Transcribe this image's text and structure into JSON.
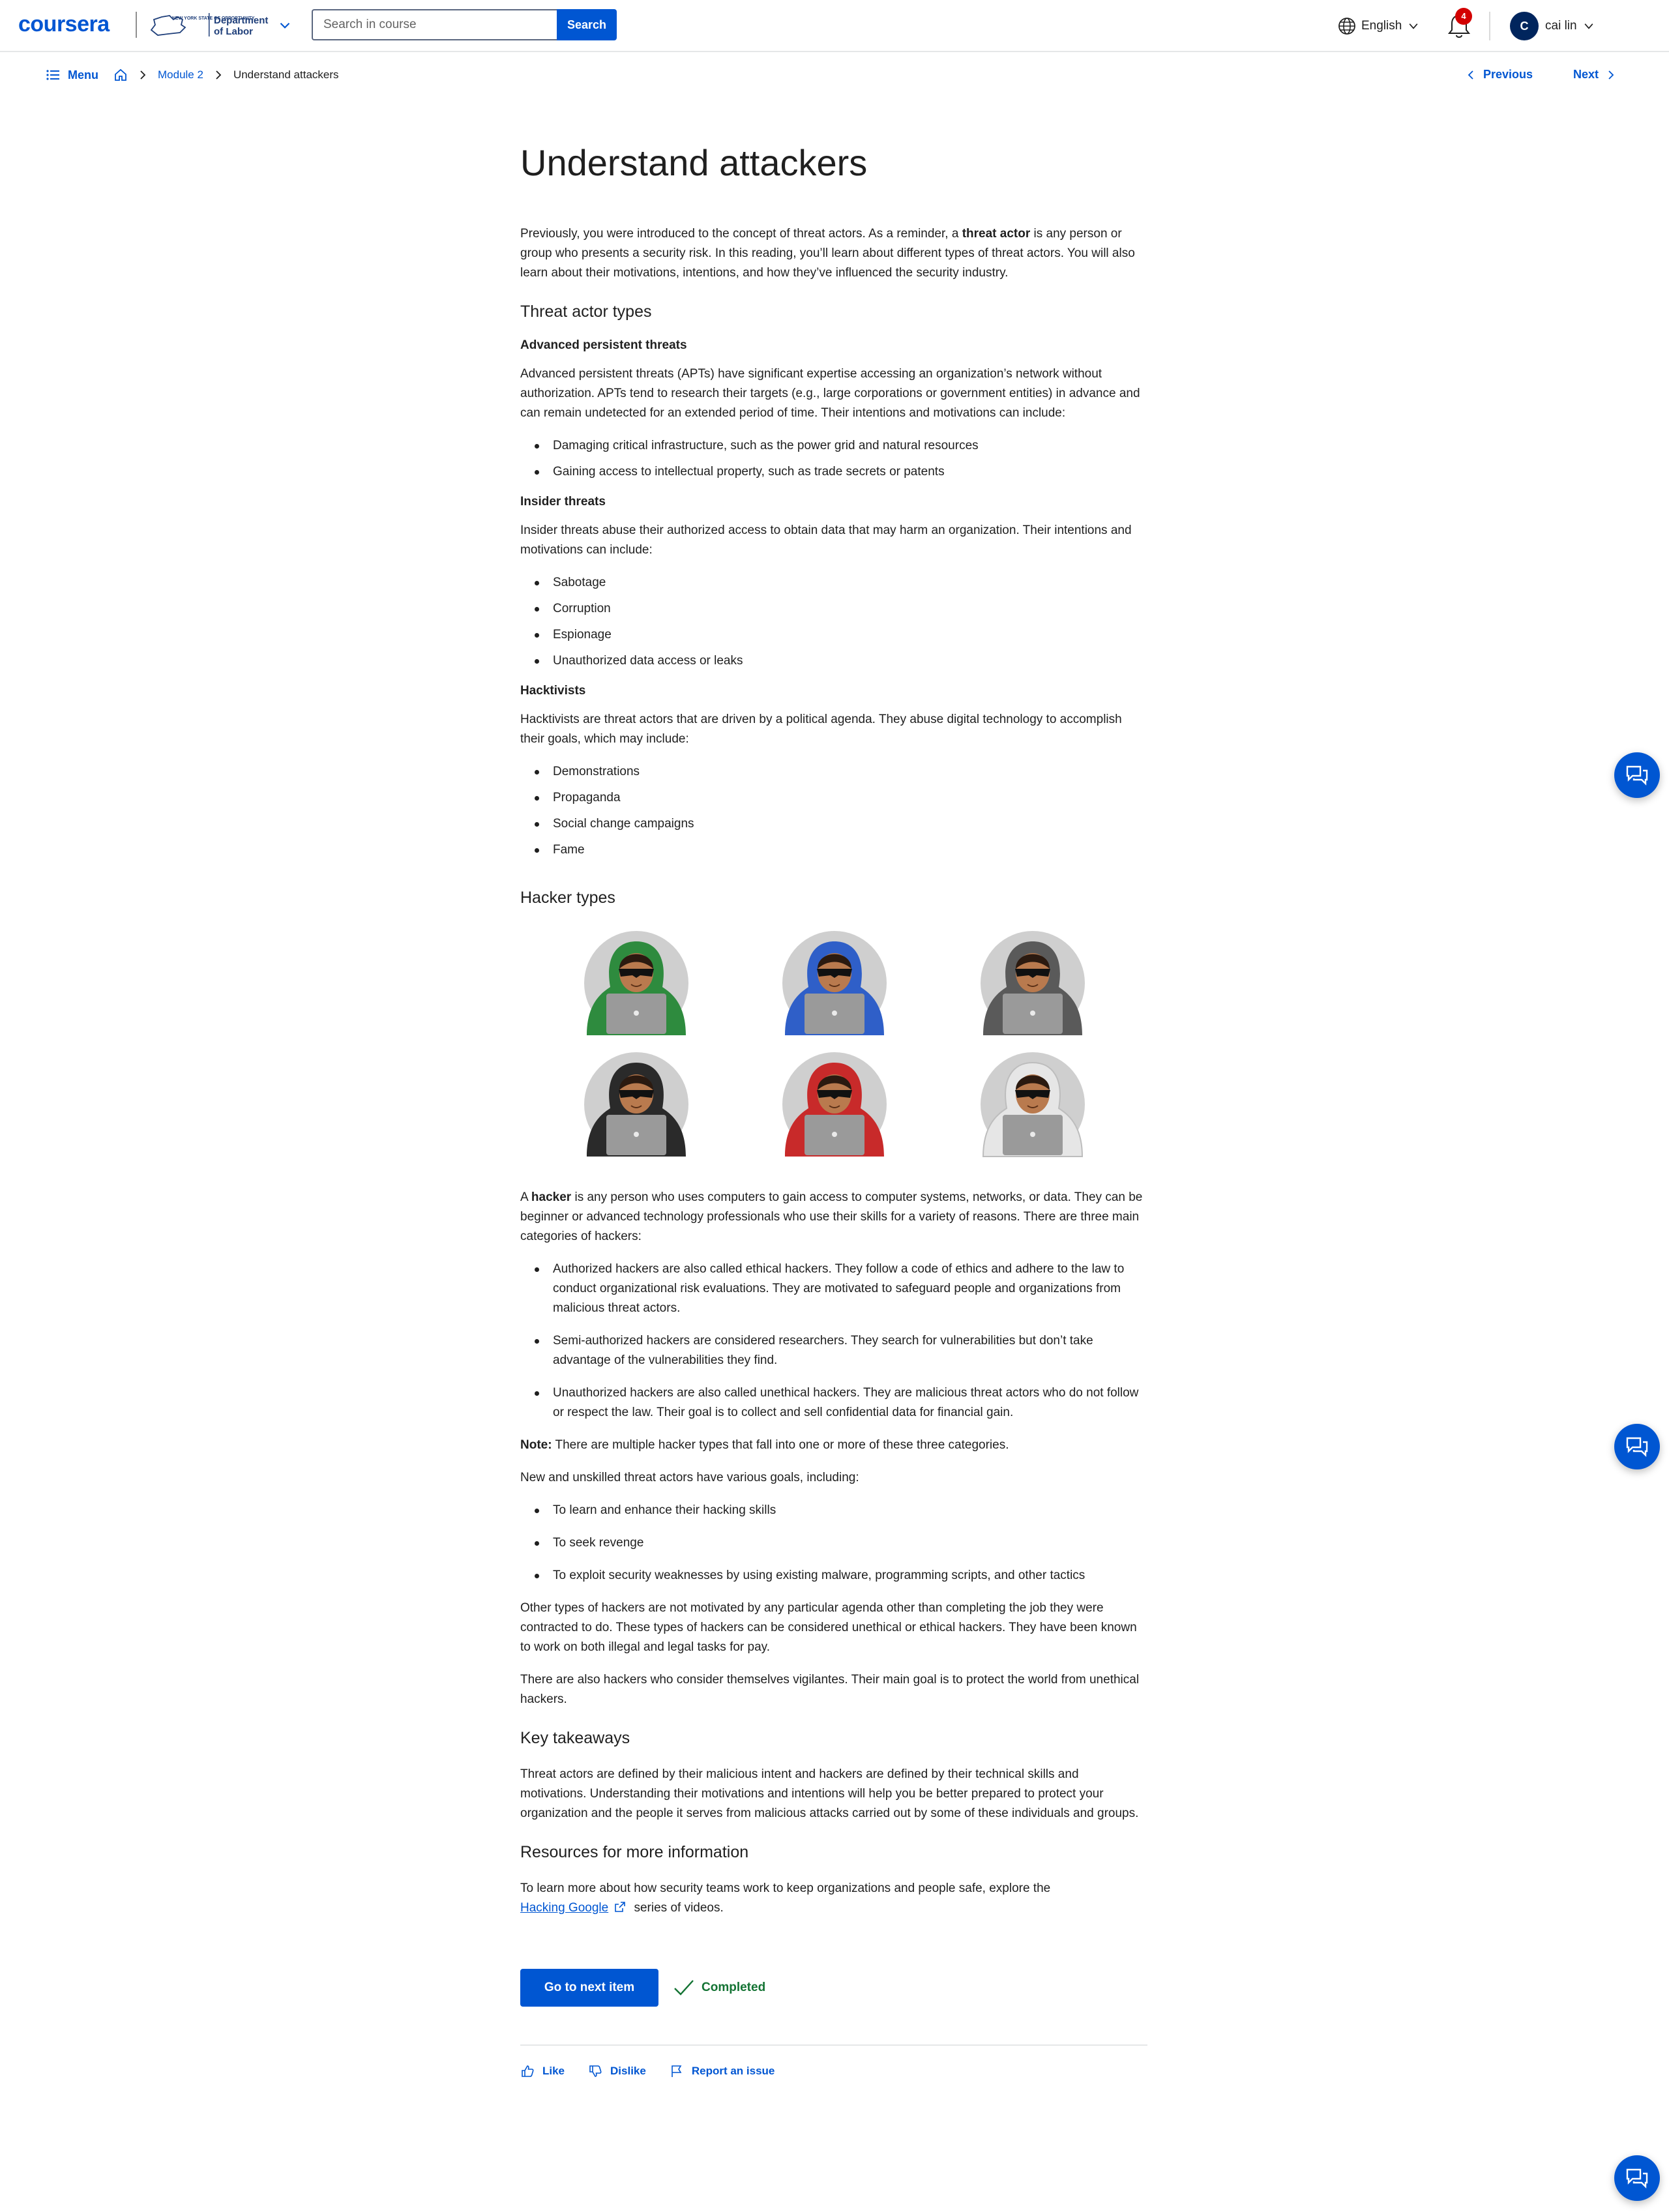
{
  "header": {
    "logo": "coursera",
    "partner_text_small": "NEW YORK STATE OF OPPORTUNITY.",
    "partner_line1": "Department",
    "partner_line2": "of Labor",
    "search_placeholder": "Search in course",
    "search_button": "Search",
    "language": "English",
    "notification_count": "4",
    "avatar_initial": "C",
    "user_name": "cai lin"
  },
  "subnav": {
    "menu_label": "Menu",
    "breadcrumb_module": "Module 2",
    "breadcrumb_current": "Understand attackers",
    "previous": "Previous",
    "next": "Next"
  },
  "article": {
    "title": "Understand attackers",
    "intro_before": "Previously, you were introduced to the concept of threat actors. As a reminder, a ",
    "intro_bold": "threat actor",
    "intro_after": " is any person or group who presents a security risk. In this reading, you’ll learn about different types of threat actors. You will also learn about their motivations, intentions, and how they’ve influenced the security industry.",
    "threat_types_heading": "Threat actor types",
    "apt_heading": "Advanced persistent threats",
    "apt_text": "Advanced persistent threats (APTs) have significant expertise accessing an organization’s network without authorization. APTs tend to research their targets (e.g., large corporations or government entities)  in advance and can remain undetected for an extended period of time. Their intentions and motivations can include:",
    "apt_items": [
      "Damaging critical infrastructure, such as the power grid and natural resources",
      "Gaining access to intellectual property, such as trade secrets or patents"
    ],
    "insider_heading": "Insider threats",
    "insider_text": "Insider threats abuse their authorized access to obtain data that may harm an organization. Their intentions and motivations can include:",
    "insider_items": [
      "Sabotage",
      "Corruption",
      "Espionage",
      "Unauthorized data access or leaks"
    ],
    "hacktivist_heading": "Hacktivists",
    "hacktivist_text": "Hacktivists are threat actors that are driven by a political agenda. They abuse digital technology to accomplish their goals, which may include:",
    "hacktivist_items": [
      "Demonstrations",
      "Propaganda",
      "Social change campaigns",
      "Fame"
    ],
    "hacker_types_heading": "Hacker types",
    "hacker_colors": [
      "#2e8b3e",
      "#2f5fc8",
      "#5a5a5a",
      "#2a2a2a",
      "#c82a2a",
      "#e6e6e6"
    ],
    "hacker_def_before": "A ",
    "hacker_def_bold": "hacker",
    "hacker_def_after": " is any person who uses computers to gain access to computer systems, networks, or data. They can be beginner or advanced technology professionals who use their skills for a variety of reasons. There are three main categories of hackers:",
    "hacker_categories": [
      "Authorized hackers are also called ethical hackers. They follow a code of ethics and adhere to the law to conduct organizational risk evaluations. They are motivated to safeguard people and organizations from malicious threat actors.",
      "Semi-authorized hackers are considered researchers. They search for vulnerabilities but don’t take advantage of the vulnerabilities they find.",
      "Unauthorized hackers are also called unethical hackers. They are malicious threat actors who do not follow or respect the law. Their goal is to collect and sell confidential data for financial gain."
    ],
    "note_label": "Note:",
    "note_text": " There are multiple hacker types that fall into one or more of these three categories.",
    "new_actors_text": "New and unskilled threat actors have various goals, including:",
    "new_actors_items": [
      "To learn and enhance their hacking skills",
      "To seek revenge",
      "To exploit security weaknesses by using existing malware, programming scripts, and other tactics"
    ],
    "other_types_text": "Other types of hackers are not motivated by any particular agenda other than completing the job they were contracted to do. These types of hackers can be considered unethical or ethical hackers. They have been known to work on both illegal and legal tasks for pay.",
    "vigilantes_text": "There are also hackers who consider themselves vigilantes. Their main goal is to protect the world from unethical hackers.",
    "takeaways_heading": "Key takeaways",
    "takeaways_text": "Threat actors are defined by their malicious intent and hackers are defined by their technical skills and motivations. Understanding their motivations and intentions will help you be better prepared to protect your organization and the people it serves from malicious attacks carried out by some of these individuals and groups.",
    "resources_heading": "Resources for more information",
    "resources_before": "To learn more about how security teams work to keep organizations and people safe, explore the ",
    "resources_link": "Hacking Google",
    "resources_after": " series of videos."
  },
  "footer": {
    "next_button": "Go to next item",
    "completed": "Completed",
    "like": "Like",
    "dislike": "Dislike",
    "report": "Report an issue"
  },
  "colors": {
    "brand": "#0056d2",
    "completed": "#137333",
    "badge": "#d30001"
  }
}
